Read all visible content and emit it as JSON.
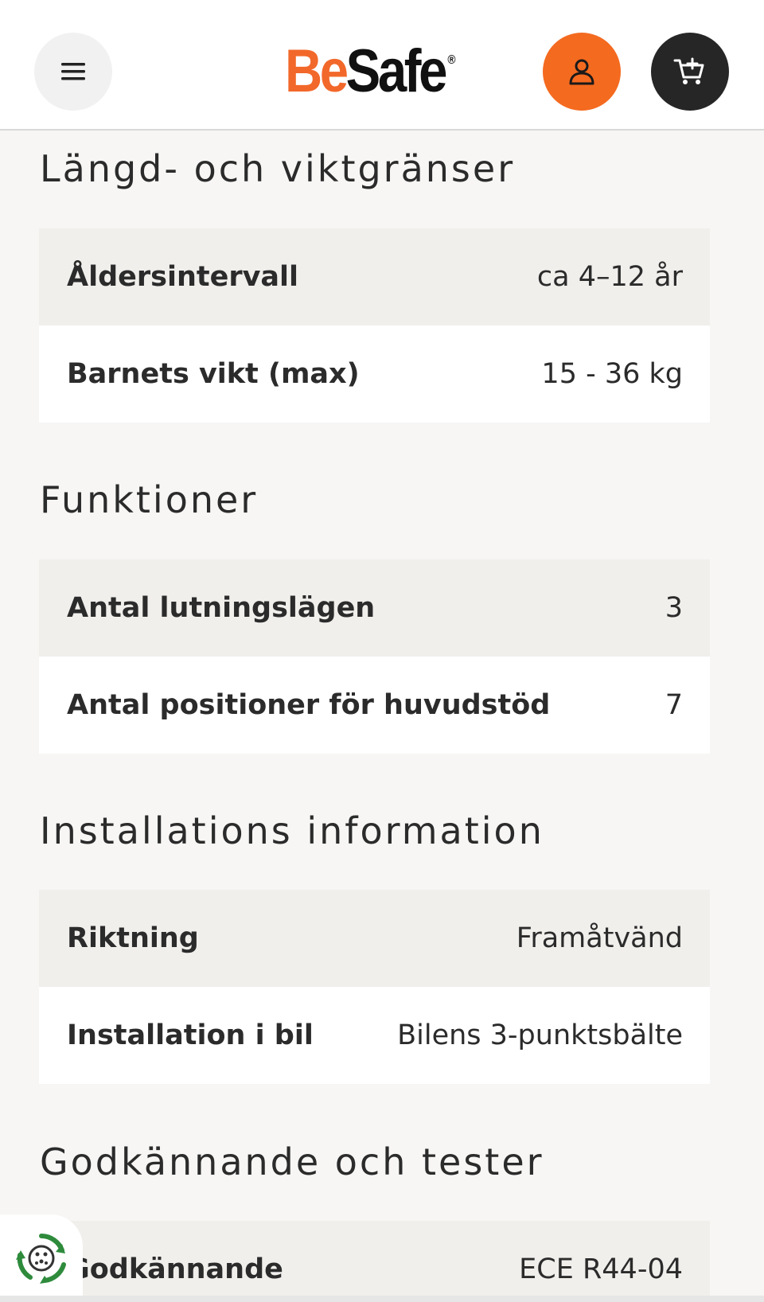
{
  "header": {
    "logo_be": "Be",
    "logo_safe": "Safe",
    "logo_reg": "®",
    "menu_icon": "hamburger-icon",
    "user_icon": "user-icon",
    "cart_icon": "cart-add-icon",
    "accent_color": "#f46a1f",
    "dark_color": "#262626"
  },
  "sections": [
    {
      "title": "Längd- och viktgränser",
      "rows": [
        {
          "label": "Åldersintervall",
          "value": "ca 4–12 år"
        },
        {
          "label": "Barnets vikt (max)",
          "value": "15 - 36 kg"
        }
      ]
    },
    {
      "title": "Funktioner",
      "rows": [
        {
          "label": "Antal lutningslägen",
          "value": "3"
        },
        {
          "label": "Antal positioner för huvudstöd",
          "value": "7"
        }
      ]
    },
    {
      "title": "Installations information",
      "rows": [
        {
          "label": "Riktning",
          "value": "Framåtvänd"
        },
        {
          "label": "Installation i bil",
          "value": "Bilens 3-punktsbälte"
        }
      ]
    },
    {
      "title": "Godkännande och tester",
      "rows": [
        {
          "label": "Godkännande",
          "value": "ECE R44-04"
        }
      ]
    }
  ],
  "eco_badge_icon": "recycle-badge-icon"
}
